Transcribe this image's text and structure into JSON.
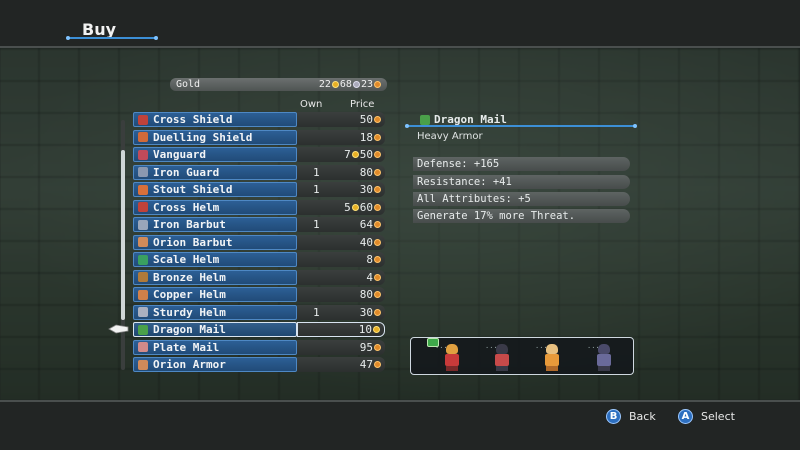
{
  "header": {
    "title": "Buy"
  },
  "gold": {
    "label": "Gold",
    "value_a": "22",
    "value_b": "68",
    "value_c": "23"
  },
  "columns": {
    "own": "Own",
    "price": "Price"
  },
  "items": [
    {
      "name": "Cross Shield",
      "own": "",
      "price": "50",
      "coin": "copper",
      "icon_color": "#c0423a"
    },
    {
      "name": "Duelling Shield",
      "own": "",
      "price": "18",
      "coin": "copper",
      "icon_color": "#d06a3a"
    },
    {
      "name": "Vanguard",
      "own": "",
      "price_a": "7",
      "price": "50",
      "coin": "copper",
      "icon_color": "#c04a5a"
    },
    {
      "name": "Iron Guard",
      "own": "1",
      "price": "80",
      "coin": "copper",
      "icon_color": "#8a98b0"
    },
    {
      "name": "Stout Shield",
      "own": "1",
      "price": "30",
      "coin": "copper",
      "icon_color": "#d8703a"
    },
    {
      "name": "Cross Helm",
      "own": "",
      "price_a": "5",
      "price": "60",
      "coin": "copper",
      "icon_color": "#c0423a"
    },
    {
      "name": "Iron Barbut",
      "own": "1",
      "price": "64",
      "coin": "copper",
      "icon_color": "#9aa6ba"
    },
    {
      "name": "Orion Barbut",
      "own": "",
      "price": "40",
      "coin": "copper",
      "icon_color": "#d08a5a"
    },
    {
      "name": "Scale Helm",
      "own": "",
      "price": "8",
      "coin": "copper",
      "icon_color": "#3aa060"
    },
    {
      "name": "Bronze Helm",
      "own": "",
      "price": "4",
      "coin": "copper",
      "icon_color": "#b07a3a"
    },
    {
      "name": "Copper Helm",
      "own": "",
      "price": "80",
      "coin": "copper",
      "icon_color": "#d0804a"
    },
    {
      "name": "Sturdy Helm",
      "own": "1",
      "price": "30",
      "coin": "copper",
      "icon_color": "#aab0c0"
    },
    {
      "name": "Dragon Mail",
      "own": "",
      "price": "10",
      "coin": "gold",
      "icon_color": "#4aa04a",
      "selected": true
    },
    {
      "name": "Plate Mail",
      "own": "",
      "price": "95",
      "coin": "copper",
      "icon_color": "#d08a8a"
    },
    {
      "name": "Orion Armor",
      "own": "",
      "price": "47",
      "coin": "copper",
      "icon_color": "#d08a5a"
    }
  ],
  "detail": {
    "name": "Dragon Mail",
    "type": "Heavy Armor",
    "stats": [
      "Defense:  +165",
      "Resistance:  +41",
      "All Attributes:  +5",
      "Generate 17% more Threat."
    ]
  },
  "party": [
    {
      "name": "member-1",
      "colors": [
        "#e0a040",
        "#c83a3a",
        "#7a2a2a"
      ],
      "equip_badge": true
    },
    {
      "name": "member-2",
      "colors": [
        "#3a3a48",
        "#c84a4a",
        "#3a3a48"
      ],
      "equip_badge": false
    },
    {
      "name": "member-3",
      "colors": [
        "#e8c080",
        "#e89a3a",
        "#b06a2a"
      ],
      "equip_badge": false
    },
    {
      "name": "member-4",
      "colors": [
        "#4a4a6a",
        "#6a6a9a",
        "#3a3a4a"
      ],
      "equip_badge": false
    }
  ],
  "footer": {
    "back_button": "B",
    "back_label": "Back",
    "select_button": "A",
    "select_label": "Select"
  }
}
